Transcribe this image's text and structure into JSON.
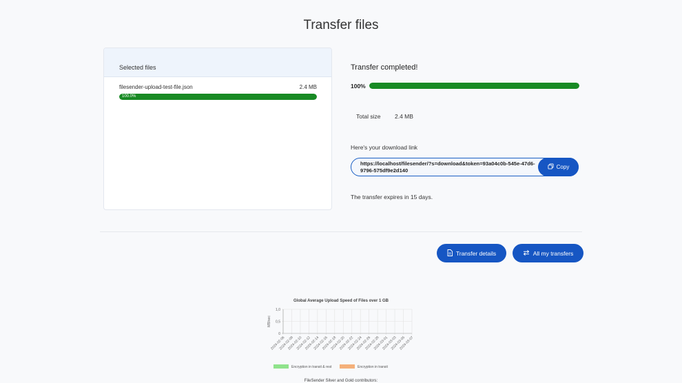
{
  "page": {
    "title": "Transfer files"
  },
  "files_card": {
    "header": "Selected files",
    "files": [
      {
        "name": "filesender-upload-test-file.json",
        "size": "2.4 MB",
        "progress_label": "100.0%",
        "progress": 1.0
      }
    ]
  },
  "status": {
    "title": "Transfer completed!",
    "overall_percent_label": "100%",
    "overall_progress": 1.0,
    "total_size_label": "Total size",
    "total_size_value": "2.4 MB",
    "download_link_label": "Here's your download link",
    "download_link": "https://localhost/filesender/?s=download&token=93a04c0b-545e-47d6-9796-575df9e2d140",
    "copy_label": "Copy",
    "expires_text": "The transfer expires in 15 days."
  },
  "actions": {
    "transfer_details_label": "Transfer details",
    "all_transfers_label": "All my transfers"
  },
  "chart_data": {
    "type": "line",
    "title": "Global Average Upload Speed of Files over 1 GB",
    "ylabel": "MB/sec",
    "xlabel": "",
    "ylim": [
      0,
      1.0
    ],
    "y_ticks": [
      "0",
      "0,5",
      "1,0"
    ],
    "categories": [
      "2024-02-06",
      "2024-02-08",
      "2024-02-10",
      "2024-02-12",
      "2024-02-14",
      "2024-02-16",
      "2024-02-18",
      "2024-02-20",
      "2024-02-22",
      "2024-02-24",
      "2024-02-26",
      "2024-02-28",
      "2024-03-01",
      "2024-03-03",
      "2024-03-05",
      "2024-03-07"
    ],
    "series": [
      {
        "name": "Encryption in transit & rest",
        "color": "#90e38c",
        "values": []
      },
      {
        "name": "Encryption in transit",
        "color": "#f4b07a",
        "values": []
      }
    ],
    "grid": true,
    "legend": "bottom"
  },
  "footer": {
    "text": "FileSender Silver and Gold contributors:"
  }
}
